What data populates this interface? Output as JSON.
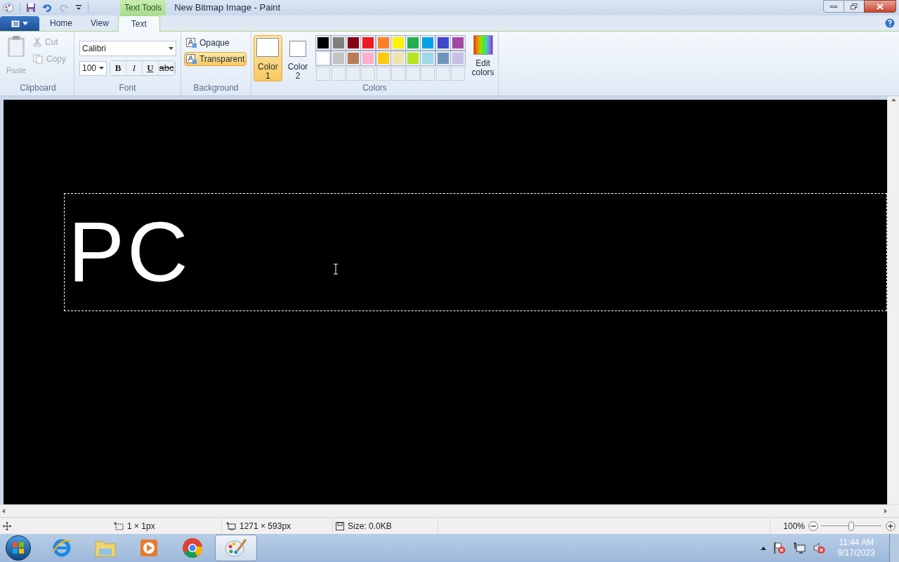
{
  "window": {
    "title": "New Bitmap Image - Paint",
    "context_tab": "Text Tools"
  },
  "tabs": [
    {
      "label": "Home",
      "selected": false
    },
    {
      "label": "View",
      "selected": false
    },
    {
      "label": "Text",
      "selected": true
    }
  ],
  "clipboard": {
    "label": "Clipboard",
    "paste": {
      "label": "Paste",
      "disabled": true
    },
    "cut": {
      "label": "Cut",
      "disabled": true
    },
    "copy": {
      "label": "Copy",
      "disabled": true
    }
  },
  "font": {
    "label": "Font",
    "family": "Calibri",
    "size": "100",
    "styles": [
      {
        "kind": "bold",
        "label": "B"
      },
      {
        "kind": "italic",
        "label": "I"
      },
      {
        "kind": "underline",
        "label": "U"
      },
      {
        "kind": "strike",
        "label": "abc"
      }
    ]
  },
  "background": {
    "label": "Background",
    "options": [
      {
        "label": "Opaque",
        "selected": false
      },
      {
        "label": "Transparent",
        "selected": true
      }
    ]
  },
  "colors": {
    "label": "Colors",
    "slots": [
      {
        "word": "Color",
        "number": "1",
        "color": "#ffffff",
        "selected": true
      },
      {
        "word": "Color",
        "number": "2",
        "color": "#ffffff",
        "selected": false
      }
    ],
    "palette": [
      {
        "color": "#000000"
      },
      {
        "color": "#7f7f7f"
      },
      {
        "color": "#880015"
      },
      {
        "color": "#ed1c24"
      },
      {
        "color": "#ff7f27"
      },
      {
        "color": "#fff200"
      },
      {
        "color": "#22b14c"
      },
      {
        "color": "#00a2e8"
      },
      {
        "color": "#3f48cc"
      },
      {
        "color": "#a349a4"
      },
      {
        "color": "#ffffff"
      },
      {
        "color": "#c3c3c3"
      },
      {
        "color": "#b97a57"
      },
      {
        "color": "#ffaec9"
      },
      {
        "color": "#ffc90e"
      },
      {
        "color": "#efe4b0"
      },
      {
        "color": "#b5e61d"
      },
      {
        "color": "#99d9ea"
      },
      {
        "color": "#7092be"
      },
      {
        "color": "#c8bfe7"
      }
    ],
    "edit_label": "Edit colors"
  },
  "canvas": {
    "text": "PC"
  },
  "status_bar": {
    "cursor": "1 × 1px",
    "canvas_size": "1271 × 593px",
    "file_size": "Size: 0.0KB",
    "zoom": "100%",
    "zoom_slider": {
      "level": 0.5
    }
  },
  "taskbar": {
    "apps": [
      {
        "kind": "browser",
        "selected": false
      },
      {
        "kind": "folder",
        "selected": false
      },
      {
        "kind": "media",
        "selected": false
      },
      {
        "kind": "chrome",
        "selected": false
      },
      {
        "kind": "paint",
        "selected": true
      }
    ],
    "time": "11:44 AM",
    "date": "9/17/2023"
  }
}
